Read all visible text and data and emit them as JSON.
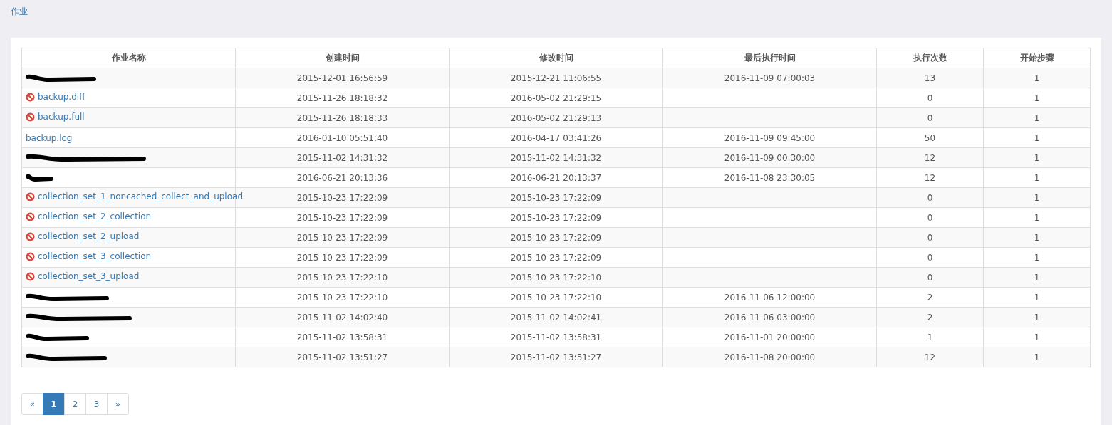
{
  "breadcrumb": {
    "label": "作业"
  },
  "table": {
    "columns": [
      "作业名称",
      "创建时间",
      "修改时间",
      "最后执行时间",
      "执行次数",
      "开始步骤"
    ],
    "rows": [
      {
        "redacted": true,
        "disabled": false,
        "created": "2015-12-01 16:56:59",
        "modified": "2015-12-21 11:06:55",
        "last_run": "2016-11-09 07:00:03",
        "runs": "13",
        "start_step": "1"
      },
      {
        "name": "backup.diff",
        "redacted": false,
        "disabled": true,
        "created": "2015-11-26 18:18:32",
        "modified": "2016-05-02 21:29:15",
        "runs": "0",
        "start_step": "1"
      },
      {
        "name": "backup.full",
        "redacted": false,
        "disabled": true,
        "created": "2015-11-26 18:18:33",
        "modified": "2016-05-02 21:29:13",
        "runs": "0",
        "start_step": "1"
      },
      {
        "name": "backup.log",
        "redacted": false,
        "disabled": false,
        "created": "2016-01-10 05:51:40",
        "modified": "2016-04-17 03:41:26",
        "last_run": "2016-11-09 09:45:00",
        "runs": "50",
        "start_step": "1"
      },
      {
        "redacted": true,
        "disabled": false,
        "created": "2015-11-02 14:31:32",
        "modified": "2015-11-02 14:31:32",
        "last_run": "2016-11-09 00:30:00",
        "runs": "12",
        "start_step": "1"
      },
      {
        "redacted": true,
        "disabled": false,
        "created": "2016-06-21 20:13:36",
        "modified": "2016-06-21 20:13:37",
        "last_run": "2016-11-08 23:30:05",
        "runs": "12",
        "start_step": "1"
      },
      {
        "name": "collection_set_1_noncached_collect_and_upload",
        "redacted": false,
        "disabled": true,
        "created": "2015-10-23 17:22:09",
        "modified": "2015-10-23 17:22:09",
        "runs": "0",
        "start_step": "1"
      },
      {
        "name": "collection_set_2_collection",
        "redacted": false,
        "disabled": true,
        "created": "2015-10-23 17:22:09",
        "modified": "2015-10-23 17:22:09",
        "runs": "0",
        "start_step": "1"
      },
      {
        "name": "collection_set_2_upload",
        "redacted": false,
        "disabled": true,
        "created": "2015-10-23 17:22:09",
        "modified": "2015-10-23 17:22:09",
        "runs": "0",
        "start_step": "1"
      },
      {
        "name": "collection_set_3_collection",
        "redacted": false,
        "disabled": true,
        "created": "2015-10-23 17:22:09",
        "modified": "2015-10-23 17:22:09",
        "runs": "0",
        "start_step": "1"
      },
      {
        "name": "collection_set_3_upload",
        "redacted": false,
        "disabled": true,
        "created": "2015-10-23 17:22:10",
        "modified": "2015-10-23 17:22:10",
        "runs": "0",
        "start_step": "1"
      },
      {
        "redacted": true,
        "disabled": false,
        "created": "2015-10-23 17:22:10",
        "modified": "2015-10-23 17:22:10",
        "last_run": "2016-11-06 12:00:00",
        "runs": "2",
        "start_step": "1"
      },
      {
        "redacted": true,
        "disabled": false,
        "created": "2015-11-02 14:02:40",
        "modified": "2015-11-02 14:02:41",
        "last_run": "2016-11-06 03:00:00",
        "runs": "2",
        "start_step": "1"
      },
      {
        "redacted": true,
        "disabled": false,
        "created": "2015-11-02 13:58:31",
        "modified": "2015-11-02 13:58:31",
        "last_run": "2016-11-01 20:00:00",
        "runs": "1",
        "start_step": "1"
      },
      {
        "redacted": true,
        "disabled": false,
        "created": "2015-11-02 13:51:27",
        "modified": "2015-11-02 13:51:27",
        "last_run": "2016-11-08 20:00:00",
        "runs": "12",
        "start_step": "1"
      }
    ]
  },
  "pagination": {
    "prev": "«",
    "next": "»",
    "pages": [
      {
        "label": "1",
        "selected": true
      },
      {
        "label": "2",
        "selected": false
      },
      {
        "label": "3",
        "selected": false
      }
    ]
  }
}
